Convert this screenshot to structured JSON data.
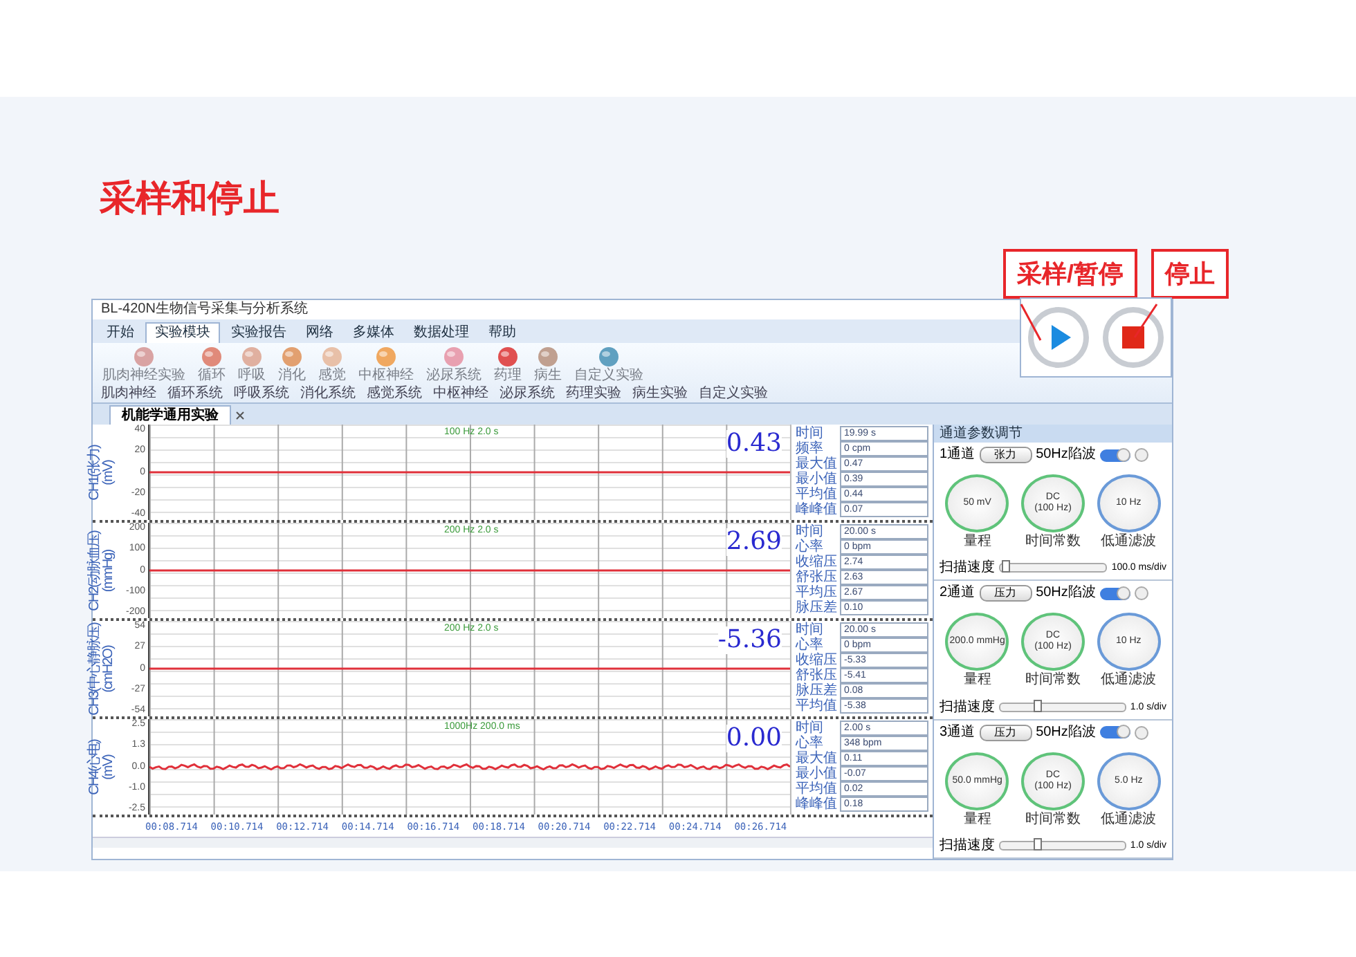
{
  "slide": {
    "title": "采样和停止"
  },
  "callouts": [
    {
      "label": "采样/暂停"
    },
    {
      "label": "停止"
    }
  ],
  "control_buttons": [
    {
      "kind": "play"
    },
    {
      "kind": "stop"
    }
  ],
  "app": {
    "title": "BL-420N生物信号采集与分析系统",
    "menu_tabs": [
      {
        "label": "开始",
        "selected": false
      },
      {
        "label": "实验模块",
        "selected": true
      },
      {
        "label": "实验报告",
        "selected": false
      },
      {
        "label": "网络",
        "selected": false
      },
      {
        "label": "多媒体",
        "selected": false
      },
      {
        "label": "数据处理",
        "selected": false
      },
      {
        "label": "帮助",
        "selected": false
      }
    ],
    "ribbon_buttons": [
      {
        "label": "肌肉神经实验"
      },
      {
        "label": "循环"
      },
      {
        "label": "呼吸"
      },
      {
        "label": "消化"
      },
      {
        "label": "感觉"
      },
      {
        "label": "中枢神经"
      },
      {
        "label": "泌尿系统"
      },
      {
        "label": "药理"
      },
      {
        "label": "病生"
      },
      {
        "label": "自定义实验"
      }
    ],
    "ribbon_groups": [
      "肌肉神经",
      "循环系统",
      "呼吸系统",
      "消化系统",
      "感觉系统",
      "中枢神经",
      "泌尿系统",
      "药理实验",
      "病生实验",
      "自定义实验"
    ],
    "document_tab": {
      "label": "机能学通用实验"
    },
    "channels": [
      {
        "label": "CH1(张力)",
        "unit": "(mV)",
        "kind": "flat",
        "yticks": [
          "40",
          "20",
          "0",
          "-20",
          "-40"
        ],
        "scale": "100 Hz 2.0 s",
        "value": "0.43",
        "readouts": [
          {
            "label": "时间",
            "value": "19.99 s"
          },
          {
            "label": "频率",
            "value": "0 cpm"
          },
          {
            "label": "最大值",
            "value": "0.47"
          },
          {
            "label": "最小值",
            "value": "0.39"
          },
          {
            "label": "平均值",
            "value": "0.44"
          },
          {
            "label": "峰峰值",
            "value": "0.07"
          }
        ]
      },
      {
        "label": "CH2(动脉血压)",
        "unit": "(mmHg)",
        "kind": "flat",
        "yticks": [
          "200",
          "100",
          "0",
          "-100",
          "-200"
        ],
        "scale": "200 Hz 2.0 s",
        "value": "2.69",
        "readouts": [
          {
            "label": "时间",
            "value": "20.00 s"
          },
          {
            "label": "心率",
            "value": "0 bpm"
          },
          {
            "label": "收缩压",
            "value": "2.74"
          },
          {
            "label": "舒张压",
            "value": "2.63"
          },
          {
            "label": "平均压",
            "value": "2.67"
          },
          {
            "label": "脉压差",
            "value": "0.10"
          }
        ]
      },
      {
        "label": "CH3(中心静脉压)",
        "unit": "(cmH2O)",
        "kind": "flat",
        "yticks": [
          "54",
          "27",
          "0",
          "-27",
          "-54"
        ],
        "scale": "200 Hz 2.0 s",
        "value": "-5.36",
        "readouts": [
          {
            "label": "时间",
            "value": "20.00 s"
          },
          {
            "label": "心率",
            "value": "0 bpm"
          },
          {
            "label": "收缩压",
            "value": "-5.33"
          },
          {
            "label": "舒张压",
            "value": "-5.41"
          },
          {
            "label": "脉压差",
            "value": "0.08"
          },
          {
            "label": "平均值",
            "value": "-5.38"
          }
        ]
      },
      {
        "label": "CH4(心电)",
        "unit": "(mV)",
        "kind": "noisy",
        "yticks": [
          "2.5",
          "1.3",
          "0.0",
          "-1.0",
          "-2.5"
        ],
        "scale": "1000Hz 200.0 ms",
        "value": "0.00",
        "readouts": [
          {
            "label": "时间",
            "value": "2.00 s"
          },
          {
            "label": "心率",
            "value": "348 bpm"
          },
          {
            "label": "最大值",
            "value": "0.11"
          },
          {
            "label": "最小值",
            "value": "-0.07"
          },
          {
            "label": "平均值",
            "value": "0.02"
          },
          {
            "label": "峰峰值",
            "value": "0.18"
          }
        ]
      }
    ],
    "x_ticks": [
      "00:08.714",
      "00:10.714",
      "00:12.714",
      "00:14.714",
      "00:16.714",
      "00:18.714",
      "00:20.714",
      "00:22.714",
      "00:24.714",
      "00:26.714"
    ],
    "panel": {
      "title": "通道参数调节",
      "channels": [
        {
          "name": "1通道",
          "signal": "张力",
          "notch_label": "50Hz陷波",
          "notch_on": true,
          "indicator_on": false,
          "knobs": [
            {
              "value": "50 mV",
              "caption": "量程"
            },
            {
              "value": "DC",
              "sub": "(100 Hz)",
              "caption": "时间常数"
            },
            {
              "value": "10 Hz",
              "caption": "低通滤波"
            }
          ],
          "speed": {
            "label": "扫描速度",
            "level": 0.05,
            "value": "100.0 ms/div"
          }
        },
        {
          "name": "2通道",
          "signal": "压力",
          "notch_label": "50Hz陷波",
          "notch_on": true,
          "indicator_on": false,
          "knobs": [
            {
              "value": "200.0 mmHg",
              "caption": "量程"
            },
            {
              "value": "DC",
              "sub": "(100 Hz)",
              "caption": "时间常数"
            },
            {
              "value": "10 Hz",
              "caption": "低通滤波"
            }
          ],
          "speed": {
            "label": "扫描速度",
            "level": 0.3,
            "value": "1.0 s/div"
          }
        },
        {
          "name": "3通道",
          "signal": "压力",
          "notch_label": "50Hz陷波",
          "notch_on": true,
          "indicator_on": false,
          "knobs": [
            {
              "value": "50.0 mmHg",
              "caption": "量程"
            },
            {
              "value": "DC",
              "sub": "(100 Hz)",
              "caption": "时间常数"
            },
            {
              "value": "5.0 Hz",
              "caption": "低通滤波"
            }
          ],
          "speed": {
            "label": "扫描速度",
            "level": 0.3,
            "value": "1.0 s/div"
          }
        }
      ]
    }
  }
}
